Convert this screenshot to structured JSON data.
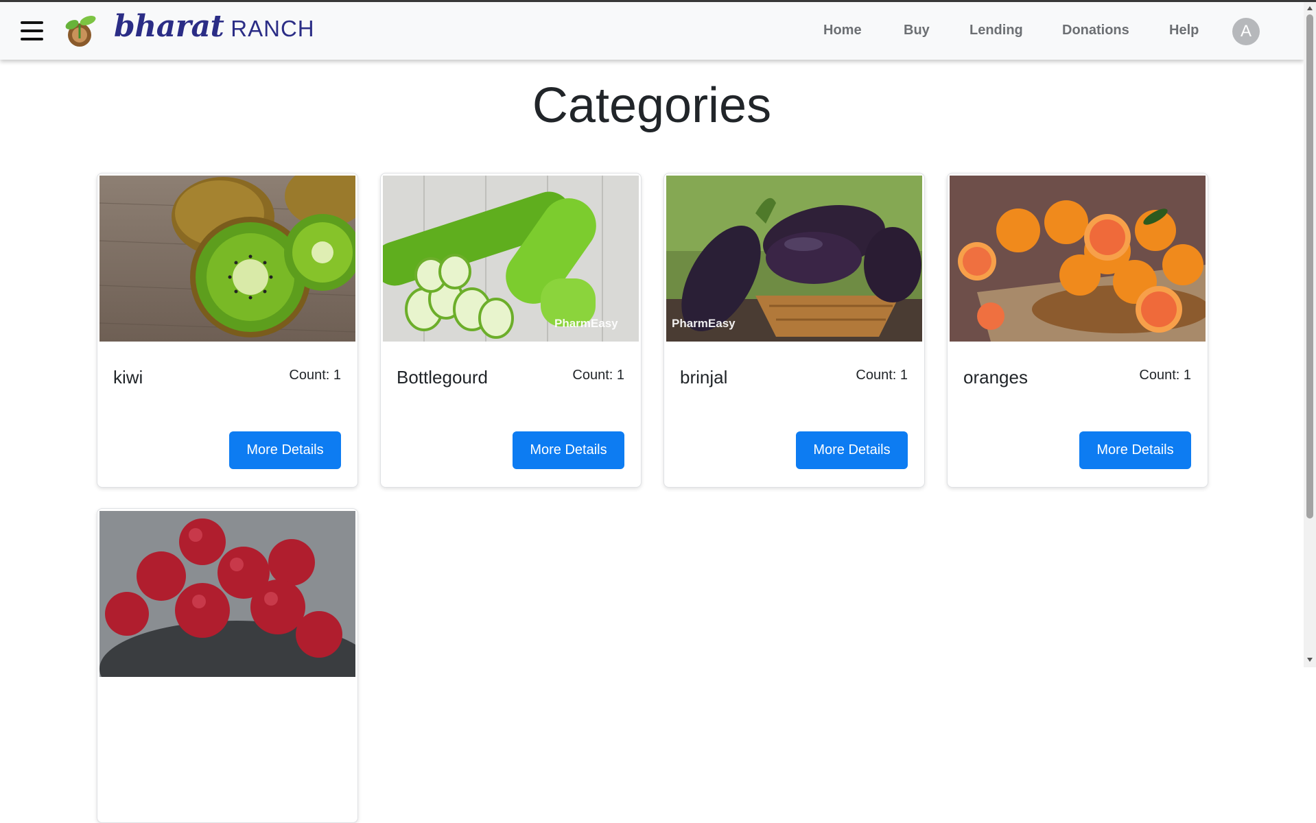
{
  "header": {
    "logo_word": "bharat",
    "logo_suffix": "RANCH",
    "menu_icon": "hamburger-menu-icon",
    "nav": [
      {
        "label": "Home"
      },
      {
        "label": "Buy"
      },
      {
        "label": "Lending"
      },
      {
        "label": "Donations"
      },
      {
        "label": "Help"
      }
    ],
    "avatar_initial": "A"
  },
  "page": {
    "title": "Categories"
  },
  "cards": [
    {
      "name": "kiwi",
      "count": "Count: 1",
      "button": "More Details"
    },
    {
      "name": "Bottlegourd",
      "count": "Count: 1",
      "button": "More Details",
      "watermark": "PharmEasy"
    },
    {
      "name": "brinjal",
      "count": "Count: 1",
      "button": "More Details",
      "watermark": "PharmEasy"
    },
    {
      "name": "oranges",
      "count": "Count: 1",
      "button": "More Details"
    },
    {}
  ],
  "colors": {
    "brand": "#2b2d86",
    "primary_button": "#0d7cf2",
    "nav_text": "#6c6f73",
    "navbar_bg": "#f8f9fa"
  }
}
